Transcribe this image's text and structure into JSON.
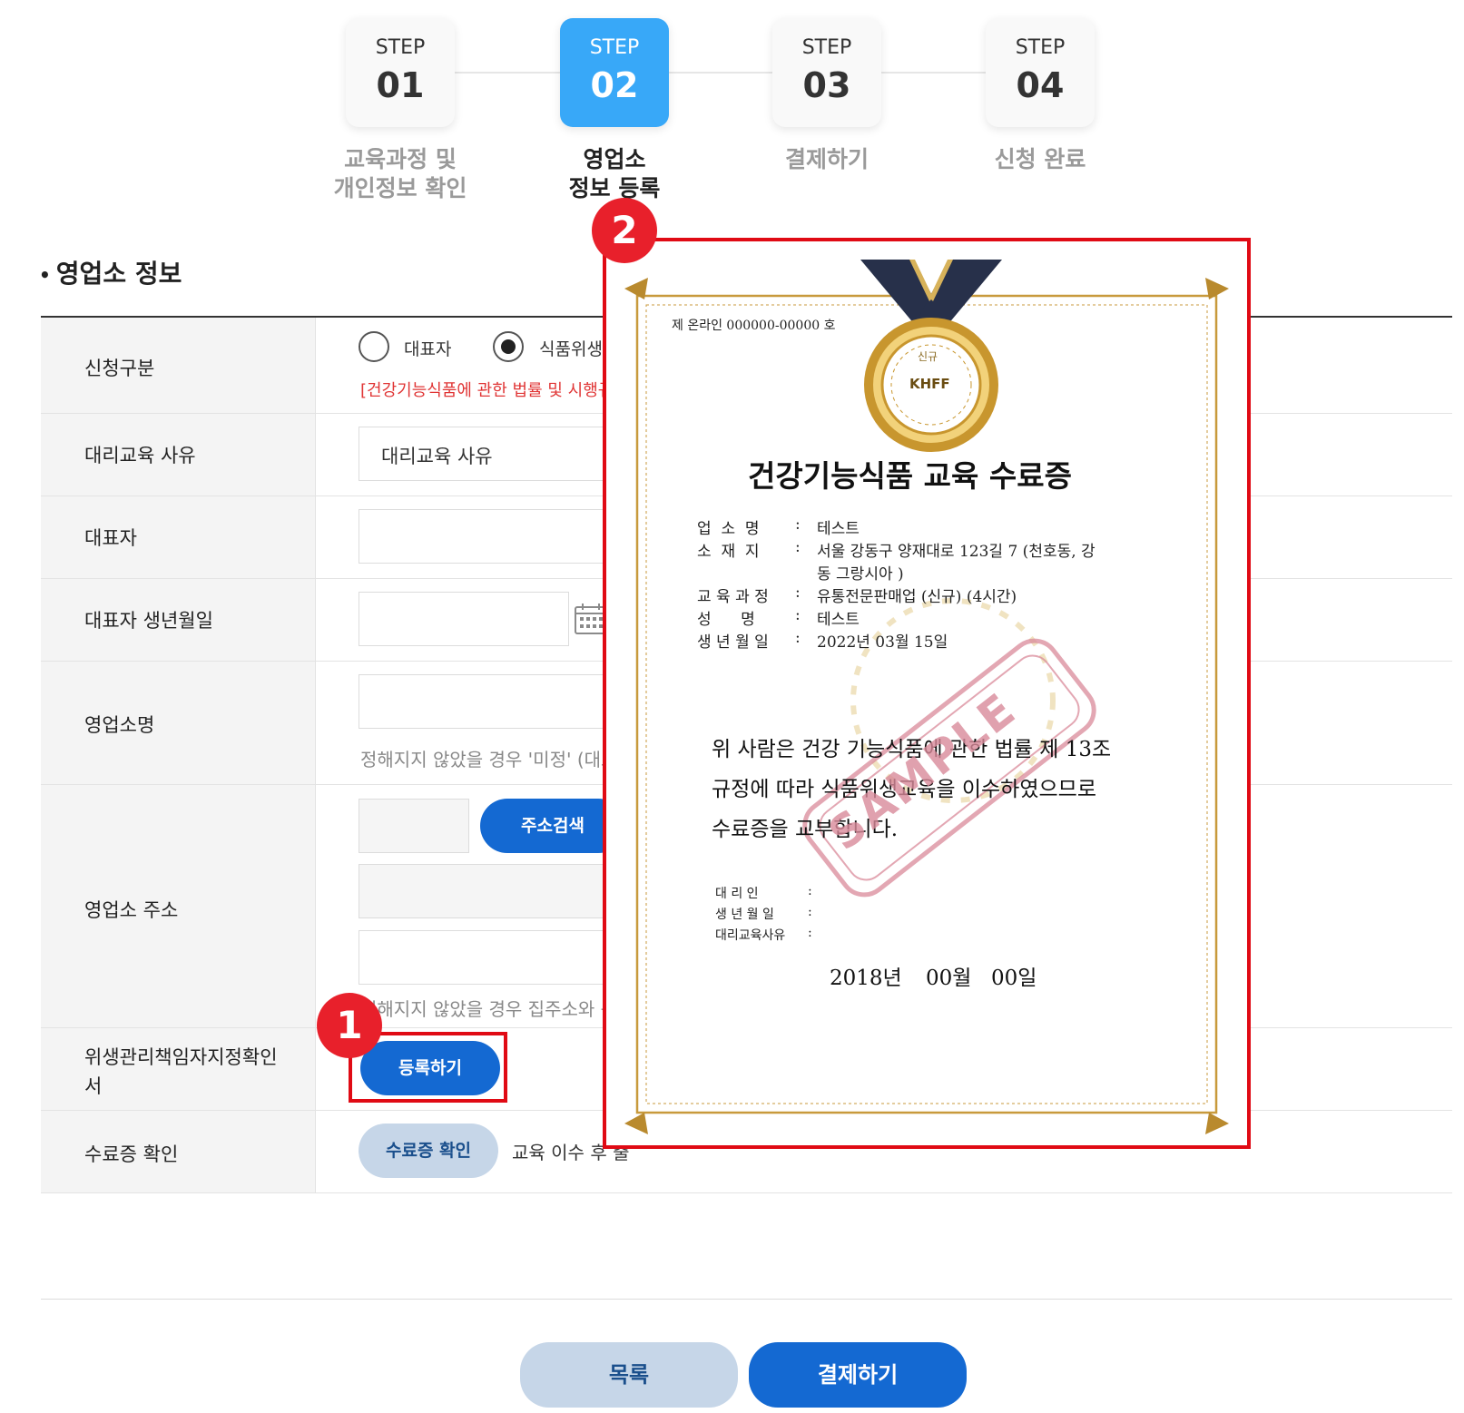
{
  "steps": [
    {
      "word": "STEP",
      "num": "01",
      "label_l1": "교육과정 및",
      "label_l2": "개인정보 확인",
      "active": false
    },
    {
      "word": "STEP",
      "num": "02",
      "label_l1": "영업소",
      "label_l2": "정보 등록",
      "active": true
    },
    {
      "word": "STEP",
      "num": "03",
      "label_l1": "결제하기",
      "label_l2": "",
      "active": false
    },
    {
      "word": "STEP",
      "num": "04",
      "label_l1": "신청 완료",
      "label_l2": "",
      "active": false
    }
  ],
  "section": {
    "bullet": "•",
    "title": "영업소 정보"
  },
  "form": {
    "apply_type": {
      "label": "신청구분",
      "options": [
        "대표자",
        "식품위생관리"
      ],
      "selected": "식품위생관리",
      "note": "[건강기능식품에 관한 법률 및 시행규칙"
    },
    "proxy_reason": {
      "label": "대리교육 사유",
      "value": "대리교육 사유"
    },
    "representative": {
      "label": "대표자",
      "value": ""
    },
    "rep_birth": {
      "label": "대표자 생년월일",
      "value": ""
    },
    "business_name": {
      "label": "영업소명",
      "value": "",
      "hint": "정해지지 않았을 경우 '미정' (대표"
    },
    "address": {
      "label": "영업소 주소",
      "search_button": "주소검색",
      "hint": "정해지지 않았을 경우 집주소와 동"
    },
    "hygiene_doc": {
      "label_l1": "위생관리책임자지정확인",
      "label_l2": "서",
      "register_button": "등록하기"
    },
    "certificate": {
      "label": "수료증 확인",
      "button": "수료증 확인",
      "note": "교육 이수 후 출"
    }
  },
  "buttons": {
    "list": "목록",
    "pay": "결제하기"
  },
  "badges": {
    "one": "1",
    "two": "2"
  },
  "certificate_preview": {
    "serial": "제 온라인 000000-00000 호",
    "medal_top": "신규",
    "medal_text": "KHFF",
    "title": "건강기능식품 교육 수료증",
    "fields": [
      {
        "key": "업  소  명",
        "value": "테스트"
      },
      {
        "key": "소  재  지",
        "value": "서울 강동구 양재대로 123길 7 (천호동, 강"
      },
      {
        "key": "",
        "value": "동 그랑시아 )"
      },
      {
        "key": "교 육 과 정",
        "value": "유통전문판매업 (신규) (4시간)"
      },
      {
        "key": "성      명",
        "value": "테스트"
      },
      {
        "key": "생 년 월 일",
        "value": "2022년 03월 15일"
      }
    ],
    "body_l1": "위 사람은 건강 기능식품에 관한 법률 제 13조",
    "body_l2": "규정에 따라 식품위생교육을 이수하였으므로",
    "body_l3": "수료증을 교부합니다.",
    "proxy_fields": [
      {
        "key": "대 리 인",
        "value": ""
      },
      {
        "key": "생 년 월 일",
        "value": ""
      },
      {
        "key": "대리교육사유",
        "value": ""
      }
    ],
    "date_year": "2018년",
    "date_month": "00월",
    "date_day": "00일",
    "stamp": "SAMPLE",
    "colors": {
      "gold": "#c89a3c",
      "ribbon": "#27304a",
      "stamp": "#d98a9a"
    }
  },
  "colors": {
    "primary": "#1469d2",
    "step_active": "#38a8f8",
    "highlight": "#e00a14",
    "pale_button": "#c6d6e8"
  }
}
